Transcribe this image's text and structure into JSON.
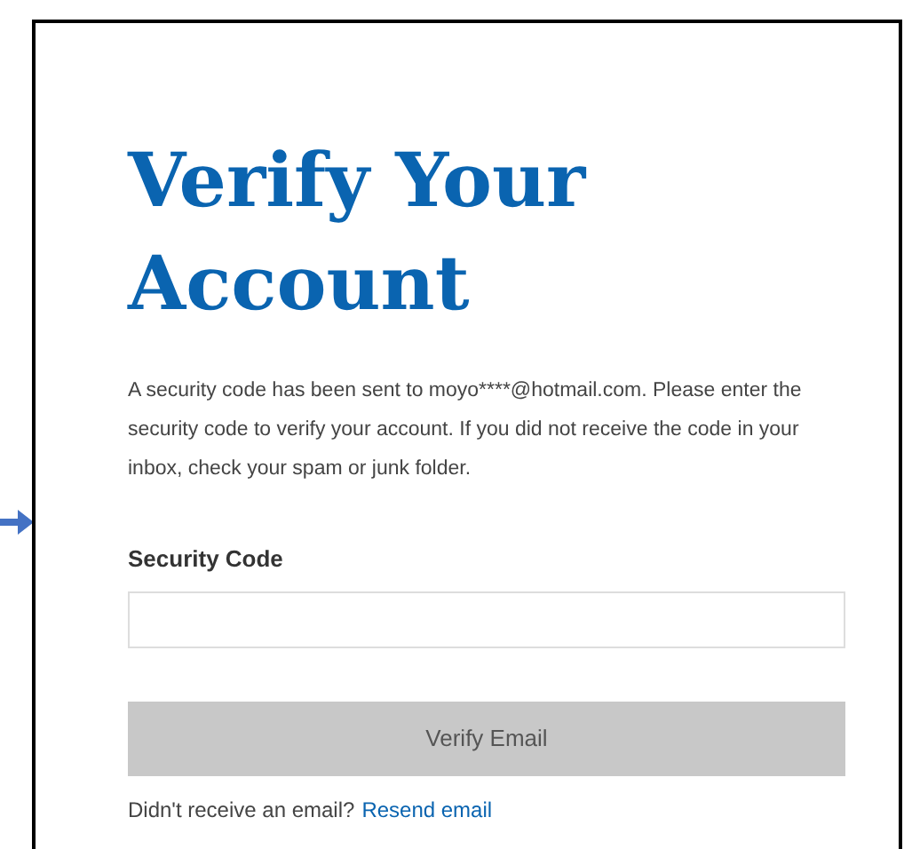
{
  "title": "Verify Your Account",
  "message": "A security code has been sent to moyo****@hotmail.com. Please enter the security code to verify your account. If you did not receive the code in your inbox, check your spam or junk folder.",
  "field": {
    "label": "Security Code"
  },
  "button": {
    "label": "Verify Email",
    "disabled": true
  },
  "footer": {
    "text": "Didn't receive an email?",
    "link": "Resend email"
  }
}
